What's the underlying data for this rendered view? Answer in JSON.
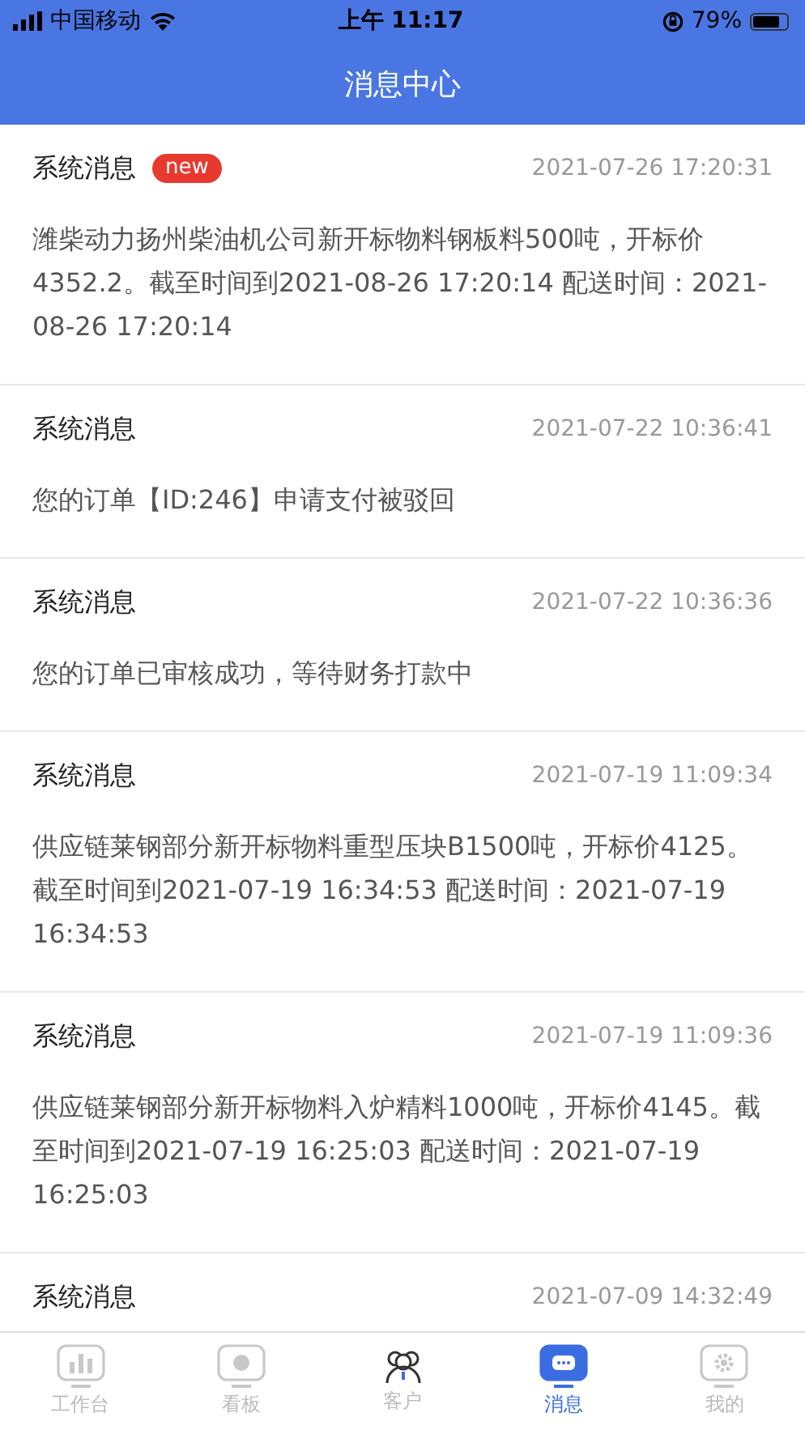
{
  "status_bar": {
    "carrier": "中国移动",
    "time": "上午 11:17",
    "battery": "79%"
  },
  "header": {
    "title": "消息中心"
  },
  "messages": [
    {
      "title": "系统消息",
      "badge": "new",
      "time": "2021-07-26 17:20:31",
      "body": "潍柴动力扬州柴油机公司新开标物料钢板料500吨，开标价4352.2。截至时间到2021-08-26 17:20:14 配送时间：2021-08-26 17:20:14"
    },
    {
      "title": "系统消息",
      "time": "2021-07-22 10:36:41",
      "body": "您的订单【ID:246】申请支付被驳回"
    },
    {
      "title": "系统消息",
      "time": "2021-07-22 10:36:36",
      "body": "您的订单已审核成功，等待财务打款中"
    },
    {
      "title": "系统消息",
      "time": "2021-07-19 11:09:34",
      "body": "供应链莱钢部分新开标物料重型压块B1500吨，开标价4125。截至时间到2021-07-19 16:34:53 配送时间：2021-07-19 16:34:53"
    },
    {
      "title": "系统消息",
      "time": "2021-07-19 11:09:36",
      "body": "供应链莱钢部分新开标物料入炉精料1000吨，开标价4145。截至时间到2021-07-19 16:25:03 配送时间：2021-07-19 16:25:03"
    },
    {
      "title": "系统消息",
      "time": "2021-07-09 14:32:49"
    }
  ],
  "tab_bar": [
    {
      "label": "工作台",
      "kind": "workbench",
      "selected": false
    },
    {
      "label": "看板",
      "kind": "board",
      "selected": false
    },
    {
      "label": "客户",
      "kind": "customers",
      "selected": false
    },
    {
      "label": "消息",
      "kind": "messages",
      "selected": true
    },
    {
      "label": "我的",
      "kind": "mine",
      "selected": false
    }
  ]
}
